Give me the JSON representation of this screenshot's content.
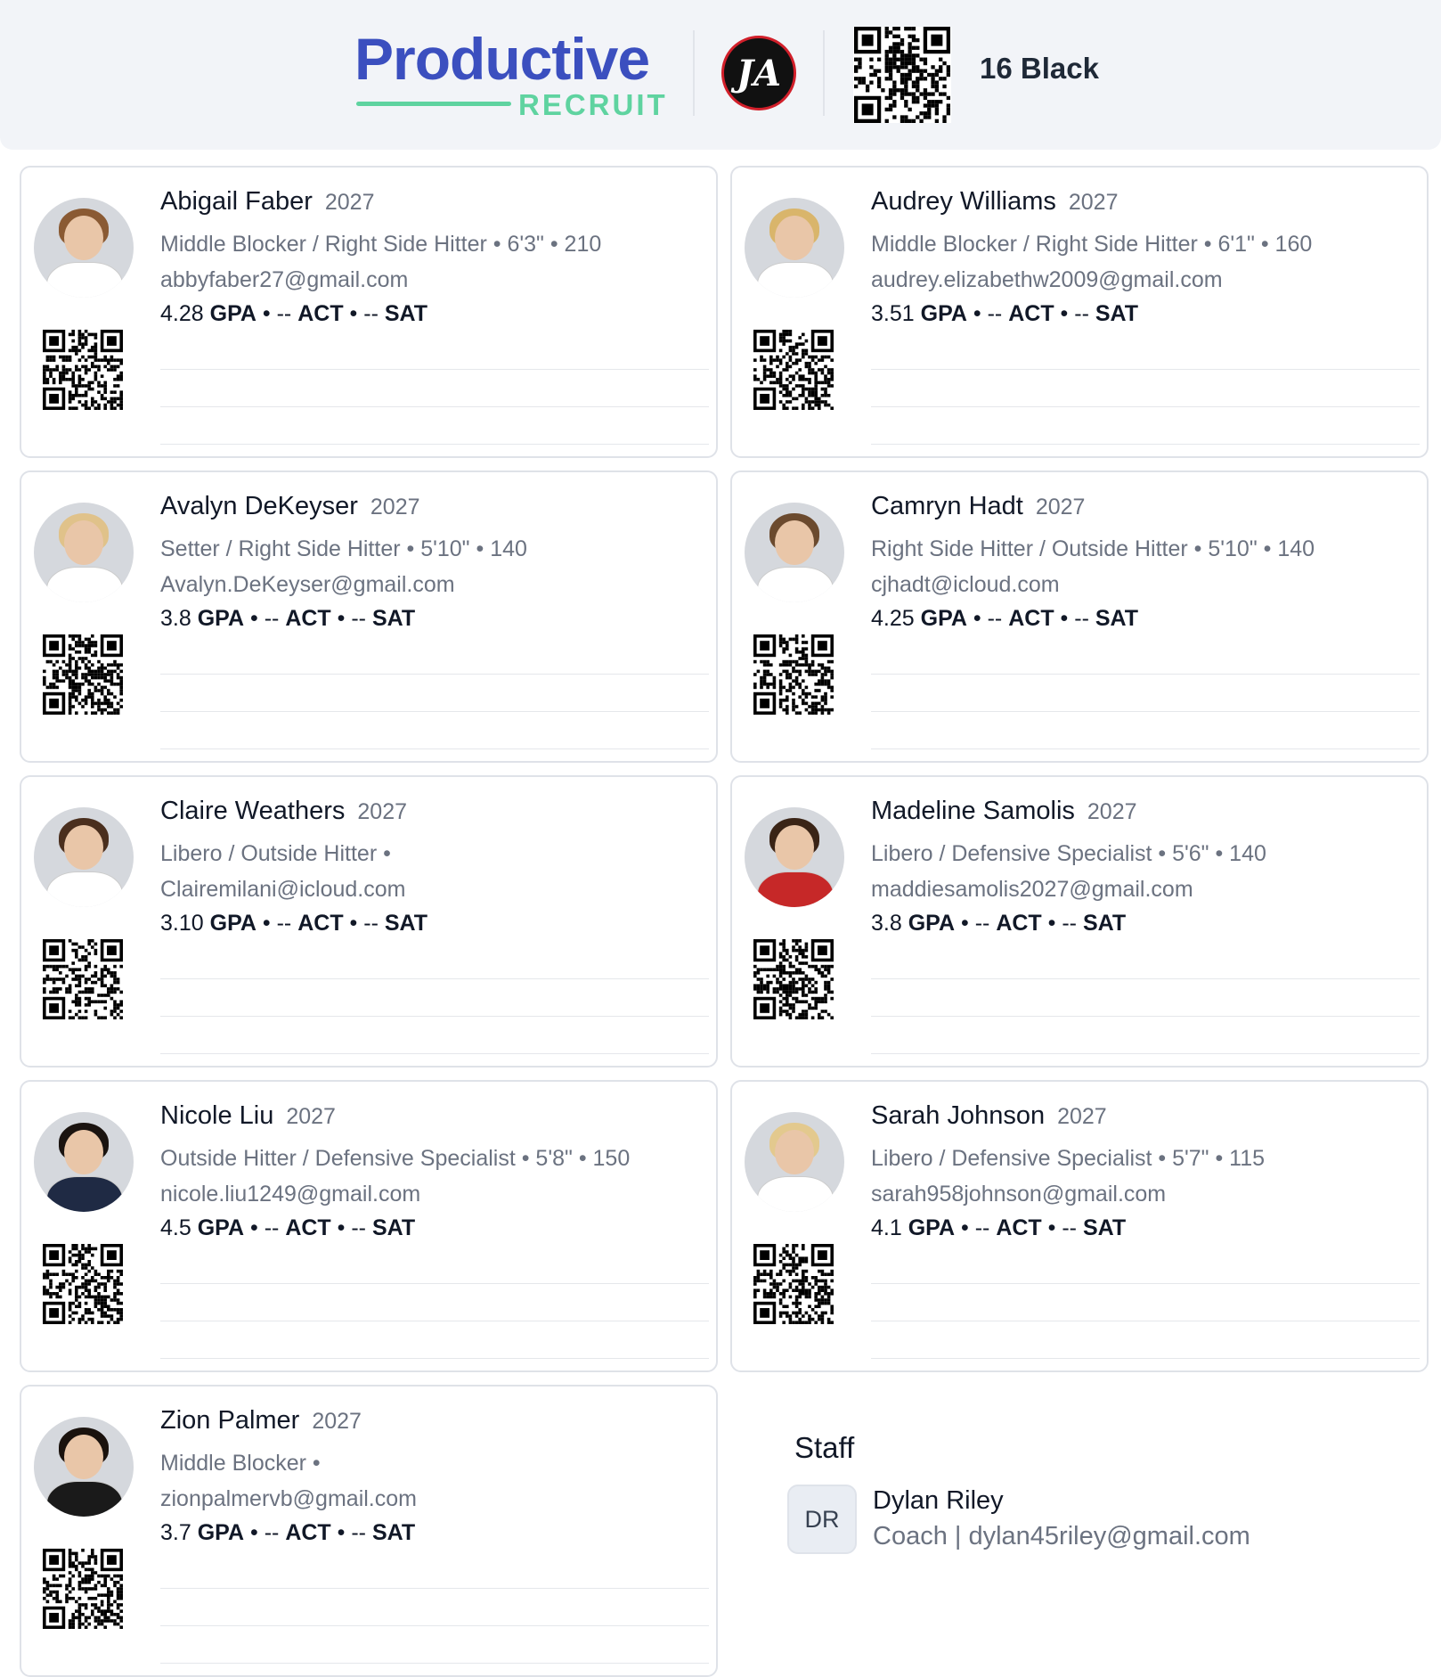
{
  "header": {
    "logo_main": "Productive",
    "logo_sub": "RECRUIT",
    "club_logo_text": "JA",
    "team_name": "16 Black"
  },
  "players": [
    {
      "name": "Abigail Faber",
      "year": "2027",
      "position": "Middle Blocker / Right Side Hitter • 6'3\" • 210",
      "email": "abbyfaber27@gmail.com",
      "gpa": "4.28",
      "act": "--",
      "sat": "--",
      "jersey_color": "#ffffff",
      "hair_color": "#8a5a33"
    },
    {
      "name": "Audrey Williams",
      "year": "2027",
      "position": "Middle Blocker / Right Side Hitter • 6'1\" • 160",
      "email": "audrey.elizabethw2009@gmail.com",
      "gpa": "3.51",
      "act": "--",
      "sat": "--",
      "jersey_color": "#ffffff",
      "hair_color": "#d9b56b"
    },
    {
      "name": "Avalyn DeKeyser",
      "year": "2027",
      "position": "Setter / Right Side Hitter • 5'10\" • 140",
      "email": "Avalyn.DeKeyser@gmail.com",
      "gpa": "3.8",
      "act": "--",
      "sat": "--",
      "jersey_color": "#ffffff",
      "hair_color": "#e0c28a"
    },
    {
      "name": "Camryn Hadt",
      "year": "2027",
      "position": "Right Side Hitter / Outside Hitter • 5'10\" • 140",
      "email": "cjhadt@icloud.com",
      "gpa": "4.25",
      "act": "--",
      "sat": "--",
      "jersey_color": "#ffffff",
      "hair_color": "#6b4a2e"
    },
    {
      "name": "Claire Weathers",
      "year": "2027",
      "position": "Libero / Outside Hitter •",
      "email": "Clairemilani@icloud.com",
      "gpa": "3.10",
      "act": "--",
      "sat": "--",
      "jersey_color": "#ffffff",
      "hair_color": "#4a2f1e"
    },
    {
      "name": "Madeline Samolis",
      "year": "2027",
      "position": "Libero / Defensive Specialist • 5'6\" • 140",
      "email": "maddiesamolis2027@gmail.com",
      "gpa": "3.8",
      "act": "--",
      "sat": "--",
      "jersey_color": "#c62828",
      "hair_color": "#3a2416"
    },
    {
      "name": "Nicole Liu",
      "year": "2027",
      "position": "Outside Hitter / Defensive Specialist • 5'8\" • 150",
      "email": "nicole.liu1249@gmail.com",
      "gpa": "4.5",
      "act": "--",
      "sat": "--",
      "jersey_color": "#1f2a44",
      "hair_color": "#1b1410"
    },
    {
      "name": "Sarah Johnson",
      "year": "2027",
      "position": "Libero / Defensive Specialist • 5'7\" • 115",
      "email": "sarah958johnson@gmail.com",
      "gpa": "4.1",
      "act": "--",
      "sat": "--",
      "jersey_color": "#ffffff",
      "hair_color": "#e3c98e"
    },
    {
      "name": "Zion Palmer",
      "year": "2027",
      "position": "Middle Blocker •",
      "email": "zionpalmervb@gmail.com",
      "gpa": "3.7",
      "act": "--",
      "sat": "--",
      "jersey_color": "#1a1a1a",
      "hair_color": "#1a120d"
    }
  ],
  "staff": {
    "title": "Staff",
    "initials": "DR",
    "name": "Dylan Riley",
    "role_line": "Coach | dylan45riley@gmail.com"
  }
}
